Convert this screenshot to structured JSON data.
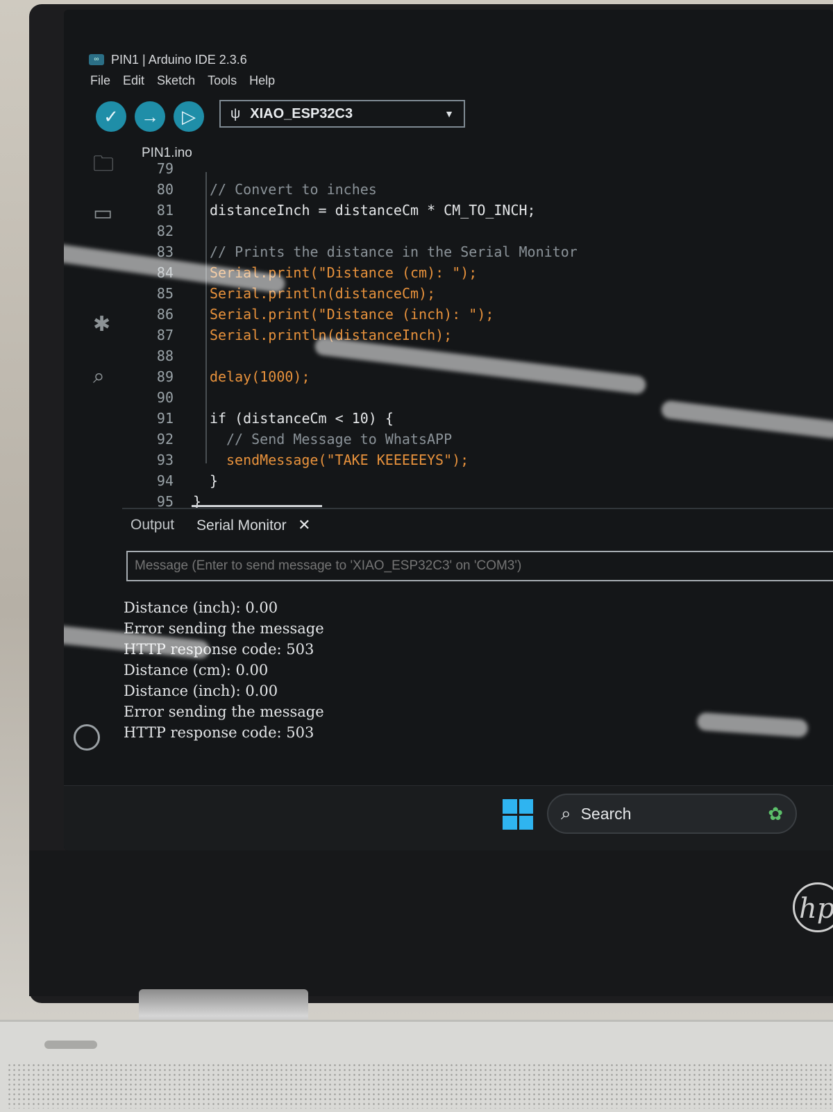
{
  "window": {
    "title": "PIN1 | Arduino IDE 2.3.6"
  },
  "menu": [
    "File",
    "Edit",
    "Sketch",
    "Tools",
    "Help"
  ],
  "toolbar": {
    "board": "XIAO_ESP32C3"
  },
  "editor": {
    "file_tab": "PIN1.ino",
    "lines": [
      {
        "n": "79",
        "code": ""
      },
      {
        "n": "80",
        "code": "// Convert to inches",
        "kind": "comment",
        "indent": 0
      },
      {
        "n": "81",
        "code": "distanceInch = distanceCm * CM_TO_INCH;",
        "kind": "plain",
        "indent": 0
      },
      {
        "n": "82",
        "code": "",
        "kind": "plain",
        "indent": 0
      },
      {
        "n": "83",
        "code": "// Prints the distance in the Serial Monitor",
        "kind": "comment",
        "indent": 0
      },
      {
        "n": "84",
        "code": "Serial.print(\"Distance (cm): \");",
        "kind": "call",
        "indent": 0
      },
      {
        "n": "85",
        "code": "Serial.println(distanceCm);",
        "kind": "call",
        "indent": 0
      },
      {
        "n": "86",
        "code": "Serial.print(\"Distance (inch): \");",
        "kind": "call",
        "indent": 0
      },
      {
        "n": "87",
        "code": "Serial.println(distanceInch);",
        "kind": "call",
        "indent": 0
      },
      {
        "n": "88",
        "code": "",
        "kind": "plain",
        "indent": 0
      },
      {
        "n": "89",
        "code": "delay(1000);",
        "kind": "call",
        "indent": 0
      },
      {
        "n": "90",
        "code": "",
        "kind": "plain",
        "indent": 0
      },
      {
        "n": "91",
        "code": "if (distanceCm < 10) {",
        "kind": "plain",
        "indent": 0
      },
      {
        "n": "92",
        "code": "// Send Message to WhatsAPP",
        "kind": "comment",
        "indent": 1
      },
      {
        "n": "93",
        "code": "sendMessage(\"TAKE KEEEEEYS\");",
        "kind": "call",
        "indent": 1
      },
      {
        "n": "94",
        "code": "}",
        "kind": "plain",
        "indent": 0
      },
      {
        "n": "95",
        "code": "}",
        "kind": "plain",
        "indent": -1
      }
    ]
  },
  "panel": {
    "tabs": [
      "Output",
      "Serial Monitor"
    ],
    "active_tab": "Serial Monitor",
    "message_placeholder": "Message (Enter to send message to 'XIAO_ESP32C3' on 'COM3')",
    "serial_lines": [
      "Distance (inch): 0.00",
      "Error sending the message",
      "HTTP response code: 503",
      "Distance (cm): 0.00",
      "Distance (inch): 0.00",
      "Error sending the message",
      "HTTP response code: 503"
    ]
  },
  "taskbar": {
    "search_label": "Search"
  },
  "colors": {
    "accent": "#1f8ea8",
    "keyword_orange": "#e8923c",
    "windows_blue": "#2fb4f0"
  }
}
